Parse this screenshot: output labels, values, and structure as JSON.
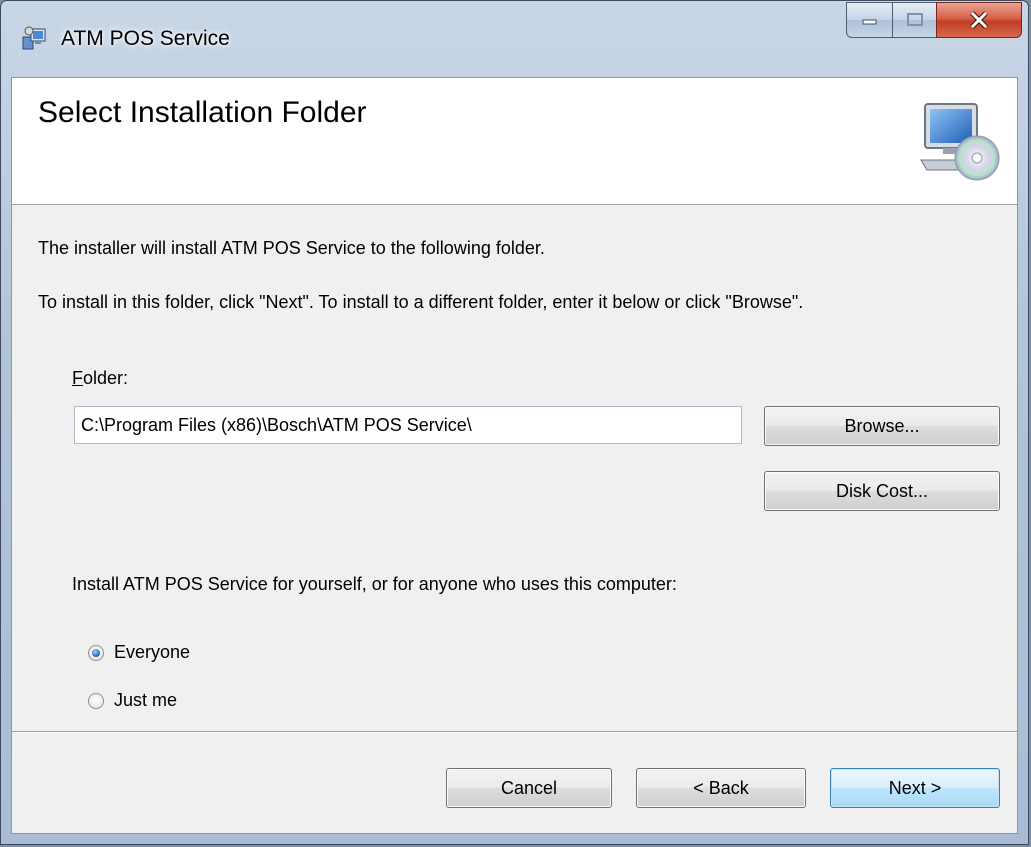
{
  "window": {
    "title": "ATM POS Service",
    "icon": "installer-icon",
    "controls": {
      "minimize": "minimize-icon",
      "maximize": "maximize-icon",
      "close": "close-icon"
    }
  },
  "header": {
    "title": "Select Installation Folder",
    "icon": "computer-cd-icon"
  },
  "body": {
    "line1": "The installer will install ATM POS Service to the following folder.",
    "line2": "To install in this folder, click \"Next\". To install to a different folder, enter it below or click \"Browse\".",
    "folder_label_mnemonic": "F",
    "folder_label_rest": "older:",
    "folder_value": "C:\\Program Files (x86)\\Bosch\\ATM POS Service\\",
    "browse_label": "Browse...",
    "disk_cost_label": "Disk Cost...",
    "install_for_prompt": "Install ATM POS Service for yourself, or for anyone who uses this computer:",
    "options": [
      {
        "label": "Everyone",
        "checked": true
      },
      {
        "label": "Just me",
        "checked": false
      }
    ]
  },
  "footer": {
    "cancel_label": "Cancel",
    "back_label": "< Back",
    "next_label": "Next >"
  },
  "colors": {
    "close_button": "#c8452b",
    "default_button": "#bee6fd",
    "dialog_background": "#f0f0f0"
  }
}
